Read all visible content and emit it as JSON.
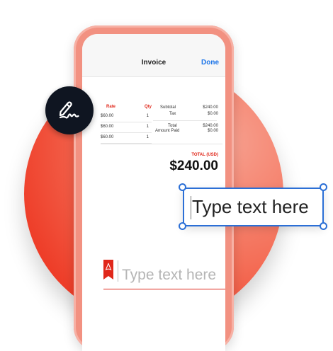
{
  "invoice": {
    "title": "Invoice",
    "done_label": "Done",
    "table": {
      "headers": [
        "Rate",
        "Qty"
      ],
      "rows": [
        {
          "rate": "$60.00",
          "qty": "1"
        },
        {
          "rate": "$60.00",
          "qty": "1"
        },
        {
          "rate": "$60.00",
          "qty": "1"
        }
      ]
    },
    "totals": {
      "subtotal_label": "Subtotal",
      "subtotal_value": "$240.00",
      "tax_label": "Tax",
      "tax_value": "$0.00",
      "total_label": "Total",
      "total_value": "$240.00",
      "amount_paid_label": "Amount Paid",
      "amount_paid_value": "$0.00"
    },
    "grand_total_label": "TOTAL (USD)",
    "grand_total_value": "$240.00"
  },
  "signature_field": {
    "placeholder": "Type text here"
  },
  "text_box": {
    "text": "Type text here"
  },
  "icons": {
    "signature": "signature-pen-icon",
    "pdf": "acrobat-pdf-icon"
  },
  "colors": {
    "accent_red": "#e0271a",
    "selection_blue": "#2b6fd6",
    "badge_dark": "#0f1521"
  }
}
